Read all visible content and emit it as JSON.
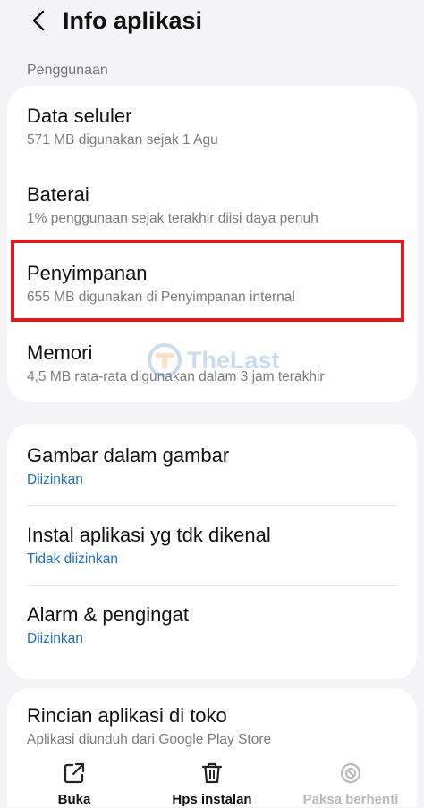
{
  "header": {
    "back_icon": "chevron-left-icon",
    "title": "Info aplikasi"
  },
  "section_label": "Penggunaan",
  "usage": [
    {
      "title": "Data seluler",
      "subtitle": "571 MB digunakan sejak 1 Agu"
    },
    {
      "title": "Baterai",
      "subtitle": "1% penggunaan sejak terakhir diisi daya penuh"
    },
    {
      "title": "Penyimpanan",
      "subtitle": "655 MB digunakan di Penyimpanan internal"
    },
    {
      "title": "Memori",
      "subtitle": "4,5 MB rata-rata digunakan dalam 3 jam terakhir"
    }
  ],
  "permissions": [
    {
      "title": "Gambar dalam gambar",
      "status": "Diizinkan"
    },
    {
      "title": "Instal aplikasi yg tdk dikenal",
      "status": "Tidak diizinkan"
    },
    {
      "title": "Alarm & pengingat",
      "status": "Diizinkan"
    }
  ],
  "store": {
    "title": "Rincian aplikasi di toko",
    "subtitle": "Aplikasi diunduh dari Google Play Store"
  },
  "watermark": {
    "text": "TheLast"
  },
  "bottom_bar": {
    "open": {
      "label": "Buka",
      "icon": "open-external-icon"
    },
    "uninstall": {
      "label": "Hps instalan",
      "icon": "trash-icon"
    },
    "force_stop": {
      "label": "Paksa berhenti",
      "icon": "block-icon"
    }
  },
  "colors": {
    "background": "#f4f4f6",
    "card": "#ffffff",
    "accent_blue": "#1b6cc2",
    "highlight_red": "#e01a1a",
    "disabled": "#b8b8b8"
  }
}
